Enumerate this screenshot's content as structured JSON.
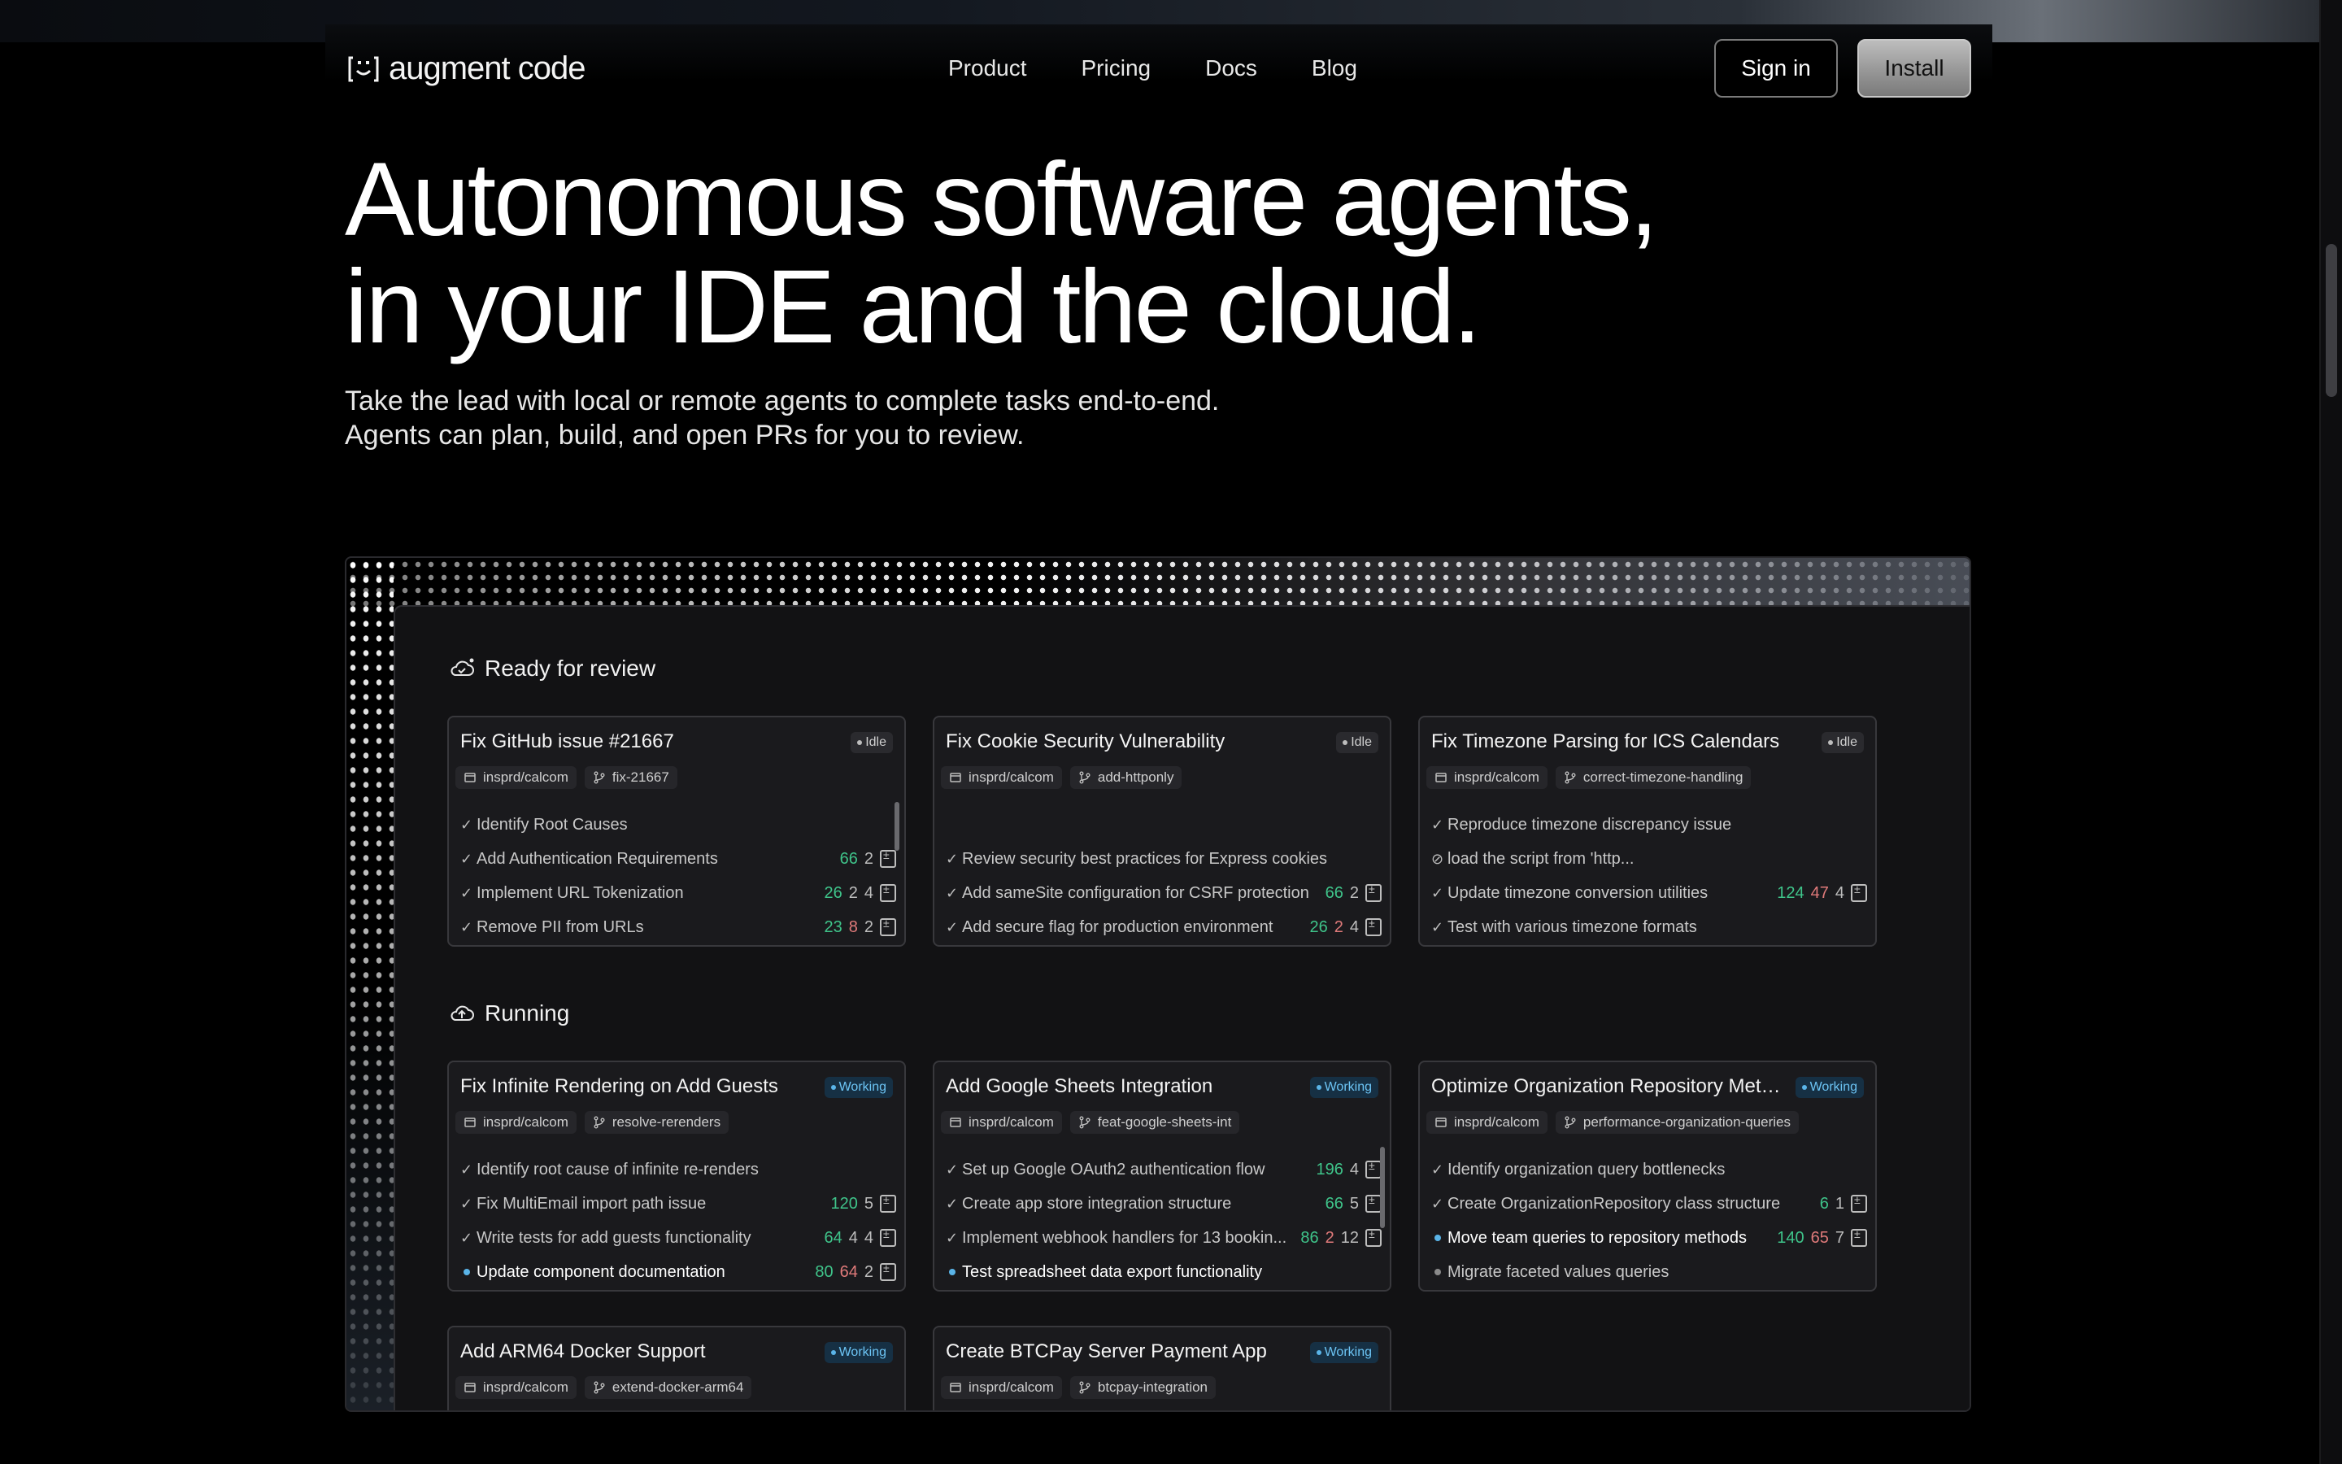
{
  "nav": {
    "logo_text": "augment code",
    "links": [
      "Product",
      "Pricing",
      "Docs",
      "Blog"
    ],
    "signin_label": "Sign in",
    "install_label": "Install"
  },
  "hero": {
    "title_line1": "Autonomous software agents,",
    "title_line2": "in your IDE and the cloud.",
    "sub_line1": "Take the lead with local or remote agents to complete tasks end-to-end.",
    "sub_line2": "Agents can plan, build, and open PRs for you to review."
  },
  "sections": {
    "review_title": "Ready for review",
    "running_title": "Running"
  },
  "review_cards": [
    {
      "title": "Fix GitHub issue #21667",
      "status": "Idle",
      "repo": "insprd/calcom",
      "branch": "fix-21667",
      "tasks": [
        {
          "label": "Identify Root Causes",
          "mark": "✓"
        },
        {
          "label": "Add Authentication Requirements",
          "mark": "✓",
          "add": "66",
          "chg": "2"
        },
        {
          "label": "Implement URL Tokenization",
          "mark": "✓",
          "add": "26",
          "chg": "2",
          "extra": "4"
        },
        {
          "label": "Remove PII from URLs",
          "mark": "✓",
          "add": "23",
          "del": "8",
          "chg": "2"
        }
      ]
    },
    {
      "title": "Fix Cookie Security Vulnerability",
      "status": "Idle",
      "repo": "insprd/calcom",
      "branch": "add-httponly",
      "tasks": [
        {
          "label": "Review security best practices for Express cookies",
          "mark": "✓"
        },
        {
          "label": "Add sameSite configuration for CSRF protection",
          "mark": "✓",
          "add": "66",
          "chg": "2"
        },
        {
          "label": "Add secure flag for production environment",
          "mark": "✓",
          "add": "26",
          "del": "2",
          "chg": "4"
        }
      ]
    },
    {
      "title": "Fix Timezone Parsing for ICS Calendars",
      "status": "Idle",
      "repo": "insprd/calcom",
      "branch": "correct-timezone-handling",
      "tasks": [
        {
          "label": "Reproduce timezone discrepancy issue",
          "mark": "✓"
        },
        {
          "label": "load the script from 'http...",
          "mark": "⃠"
        },
        {
          "label": "Update timezone conversion utilities",
          "mark": "✓",
          "add": "124",
          "del": "47",
          "chg": "4"
        },
        {
          "label": "Test with various timezone formats",
          "mark": "✓"
        }
      ]
    }
  ],
  "running_cards": [
    {
      "title": "Fix Infinite Rendering on Add Guests",
      "status": "Working",
      "repo": "insprd/calcom",
      "branch": "resolve-rerenders",
      "tasks": [
        {
          "label": "Identify root cause of infinite re-renders",
          "mark": "✓"
        },
        {
          "label": "Fix MultiEmail import path issue",
          "mark": "✓",
          "add": "120",
          "chg": "5"
        },
        {
          "label": "Write tests for add guests functionality",
          "mark": "✓",
          "add": "64",
          "chg": "4",
          "extra": "4"
        },
        {
          "label": "Update component documentation",
          "mark": "•",
          "add": "80",
          "del": "64",
          "chg": "2",
          "active": true
        }
      ]
    },
    {
      "title": "Add Google Sheets Integration",
      "status": "Working",
      "repo": "insprd/calcom",
      "branch": "feat-google-sheets-int",
      "tasks": [
        {
          "label": "Set up Google OAuth2 authentication flow",
          "mark": "✓",
          "add": "196",
          "chg": "4"
        },
        {
          "label": "Create app store integration structure",
          "mark": "✓",
          "add": "66",
          "chg": "5"
        },
        {
          "label": "Implement webhook handlers for 13 bookin...",
          "mark": "✓",
          "add": "86",
          "del": "2",
          "chg": "12"
        },
        {
          "label": "Test spreadsheet data export functionality",
          "mark": "•",
          "active": true
        }
      ]
    },
    {
      "title": "Optimize Organization Repository Metho...",
      "status": "Working",
      "repo": "insprd/calcom",
      "branch": "performance-organization-queries",
      "tasks": [
        {
          "label": "Identify organization query bottlenecks",
          "mark": "✓"
        },
        {
          "label": "Create OrganizationRepository class structure",
          "mark": "✓",
          "add": "6",
          "chg": "1"
        },
        {
          "label": "Move team queries to repository methods",
          "mark": "•",
          "add": "140",
          "del": "65",
          "chg": "7",
          "active": true
        },
        {
          "label": "Migrate faceted values queries",
          "mark": "•",
          "pending": true
        }
      ]
    },
    {
      "title": "Add ARM64 Docker Support",
      "status": "Working",
      "repo": "insprd/calcom",
      "branch": "extend-docker-arm64",
      "tasks": []
    },
    {
      "title": "Create BTCPay Server Payment App",
      "status": "Working",
      "repo": "insprd/calcom",
      "branch": "btcpay-integration",
      "tasks": []
    }
  ]
}
